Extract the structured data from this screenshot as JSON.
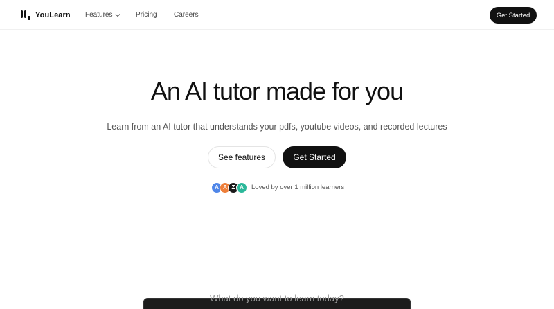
{
  "nav": {
    "brand": "YouLearn",
    "links": [
      {
        "label": "Features",
        "has_dropdown": true
      },
      {
        "label": "Pricing"
      },
      {
        "label": "Careers"
      }
    ],
    "cta": "Get Started"
  },
  "hero": {
    "title": "An AI tutor made for you",
    "subtitle": "Learn from an AI tutor that understands your pdfs, youtube videos, and recorded lectures",
    "primary_button": "Get Started",
    "secondary_button": "See features",
    "social_proof": "Loved by over 1 million learners",
    "avatars": [
      {
        "initial": "A",
        "color": "#4f86e8"
      },
      {
        "initial": "A",
        "color": "#ee7f3b"
      },
      {
        "initial": "Z",
        "color": "#1a1a1a"
      },
      {
        "initial": "A",
        "color": "#2bb89a"
      }
    ]
  },
  "preview": {
    "prompt": "What do you want to learn today?"
  },
  "colors": {
    "primary": "#111111",
    "text_muted": "#555555",
    "background": "#ffffff"
  }
}
